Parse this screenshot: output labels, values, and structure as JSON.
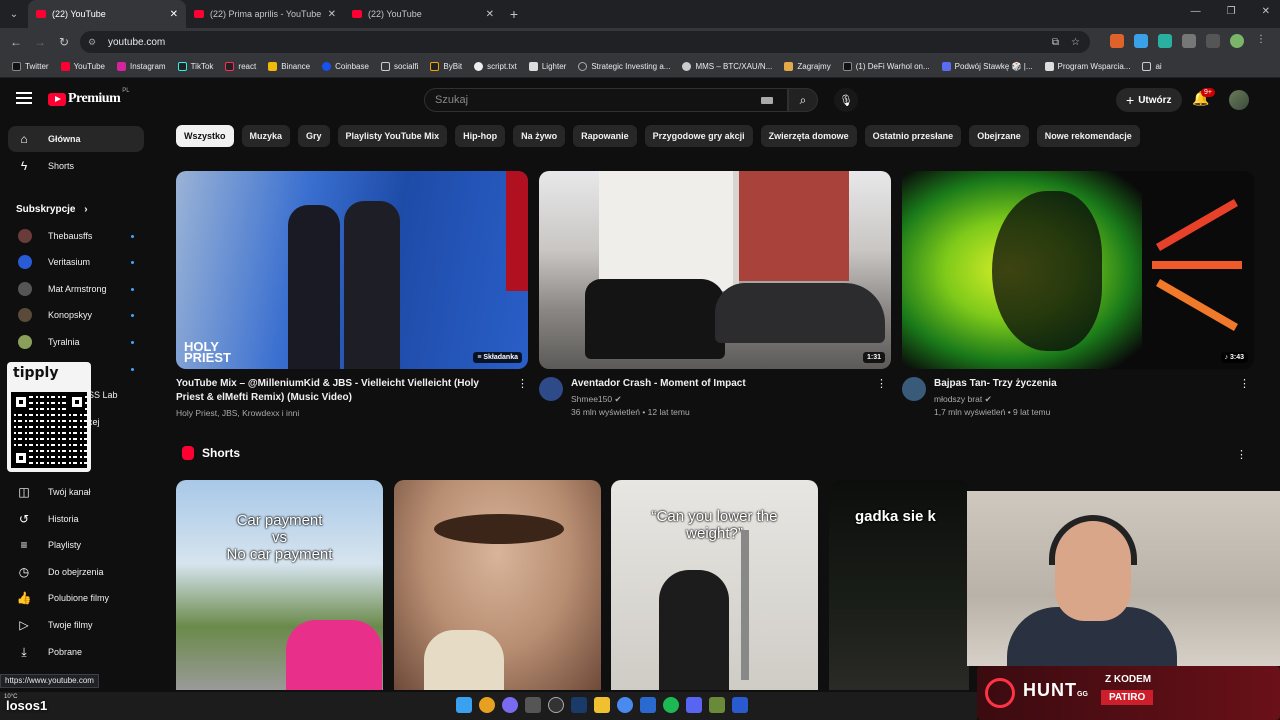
{
  "browser": {
    "tabs": [
      {
        "title": "(22) YouTube",
        "active": true
      },
      {
        "title": "(22) Prima aprilis - YouTube",
        "active": false
      },
      {
        "title": "(22) YouTube",
        "active": false
      }
    ],
    "url": "youtube.com",
    "bookmarks": [
      "Twitter",
      "YouTube",
      "Instagram",
      "TikTok",
      "react",
      "Binance",
      "Coinbase",
      "socialfi",
      "ByBit",
      "script.txt",
      "Lighter",
      "Strategic Investing a...",
      "MMS – BTC/XAU/N...",
      "Zagrajmy",
      "(1) DeFi Warhol on...",
      "Podwój Stawkę 🎲 |...",
      "Program Wsparcia...",
      "ai"
    ],
    "status_url": "https://www.youtube.com"
  },
  "header": {
    "logo": "Premium",
    "region": "PL",
    "search_placeholder": "Szukaj",
    "create_label": "Utwórz",
    "notifications": "9+"
  },
  "sidebar": {
    "home": "Główna",
    "shorts": "Shorts",
    "subscriptions_heading": "Subskrypcje",
    "subscriptions": [
      {
        "name": "Thebausffs",
        "color": "#6a3b3b"
      },
      {
        "name": "Veritasium",
        "color": "#2a5bd7"
      },
      {
        "name": "Mat Armstrong",
        "color": "#555555"
      },
      {
        "name": "Konopskyy",
        "color": "#5a4a3a"
      },
      {
        "name": "Tyralnia",
        "color": "#8aa05a"
      }
    ],
    "partial": [
      "SS Lab",
      "cej"
    ],
    "you_items": [
      "Twój kanał",
      "Historia",
      "Playlisty",
      "Do obejrzenia",
      "Polubione filmy",
      "Twoje filmy",
      "Pobrane"
    ]
  },
  "chips": [
    "Wszystko",
    "Muzyka",
    "Gry",
    "Playlisty YouTube Mix",
    "Hip-hop",
    "Na żywo",
    "Rapowanie",
    "Przygodowe gry akcji",
    "Zwierzęta domowe",
    "Ostatnio przesłane",
    "Obejrzane",
    "Nowe rekomendacje"
  ],
  "videos": [
    {
      "title": "YouTube Mix – @MilleniumKid  & JBS - Vielleicht Vielleicht (Holy Priest & elMefti Remix) (Music Video)",
      "sub": "Holy Priest, JBS, Krowdexx i inni",
      "badge": "Składanka"
    },
    {
      "title": "Aventador Crash - Moment of Impact",
      "channel": "Shmee150",
      "stats": "36 mln wyświetleń • 12 lat temu",
      "badge": "1:31"
    },
    {
      "title": "Bajpas Tan- Trzy życzenia",
      "channel": "młodszy brat",
      "stats": "1,7 mln wyświetleń • 9 lat temu",
      "badge": "3:43"
    }
  ],
  "shorts": {
    "heading": "Shorts",
    "items": [
      {
        "text": "Car payment\nvs\nNo car payment"
      },
      {
        "text": ""
      },
      {
        "text": "“Can you lower the\nweight?”"
      },
      {
        "text": "gadka sie k"
      }
    ]
  },
  "overlays": {
    "qr_brand": "tipply",
    "hunt_brand": "HUNT",
    "hunt_suffix": "GG",
    "code_label": "Z KODEM",
    "code_value": "PATIRO",
    "streamer": "losos1",
    "weather": "10°C"
  }
}
